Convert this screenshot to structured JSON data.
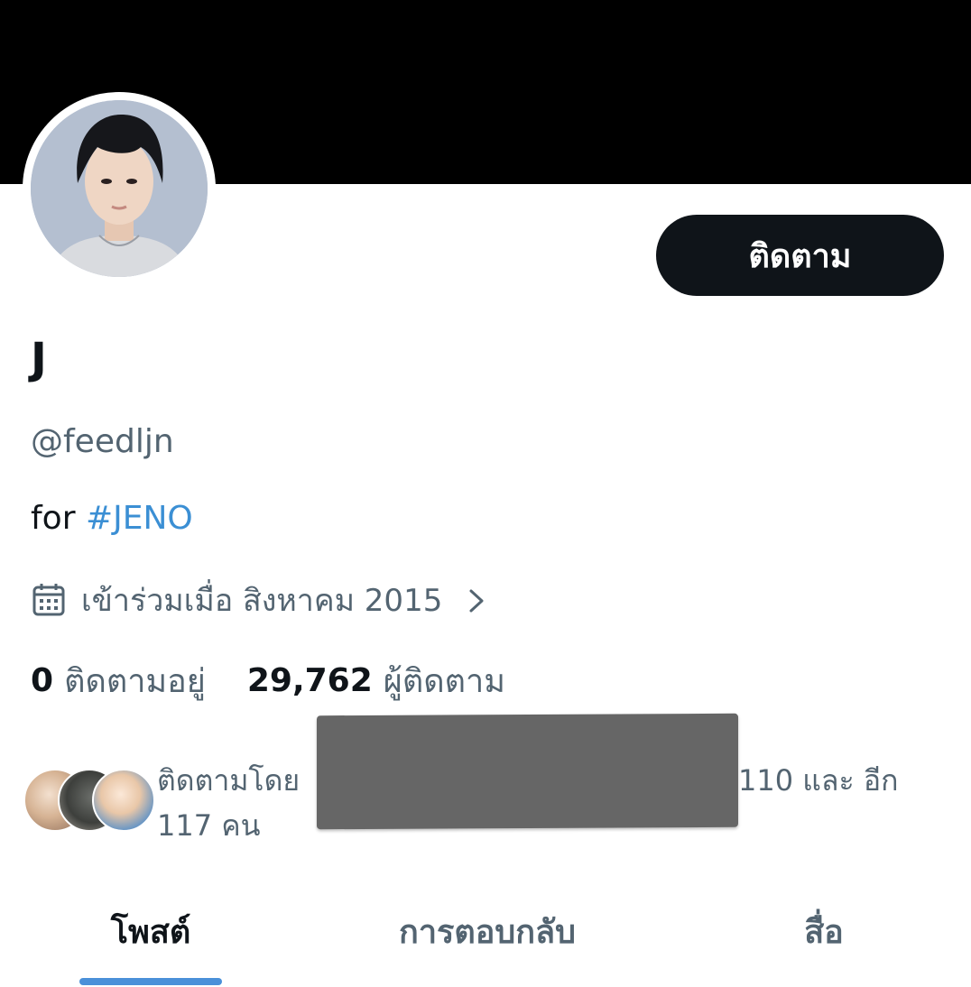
{
  "profile": {
    "display_name": "J",
    "handle": "@feedljn",
    "bio_prefix": "for ",
    "bio_hashtag": "#JENO",
    "joined": "เข้าร่วมเมื่อ สิงหาคม 2015",
    "follow_button": "ติดตาม"
  },
  "stats": {
    "following_count": "0",
    "following_label": "ติดตามอยู่",
    "followers_count": "29,762",
    "followers_label": "ผู้ติดตาม"
  },
  "followed_by": {
    "prefix": "ติดตามโดย",
    "suffix": "110 และ อีก",
    "line2": "117 คน"
  },
  "tabs": [
    {
      "label": "โพสต์"
    },
    {
      "label": "การตอบกลับ"
    },
    {
      "label": "สื่อ"
    }
  ],
  "colors": {
    "banner": "#000000",
    "accent": "#3b8fd4",
    "text_primary": "#0f1419",
    "text_secondary": "#536471",
    "redaction": "#666666"
  },
  "icons": {
    "joined": "calendar-icon",
    "joined_more": "chevron-right-icon"
  }
}
